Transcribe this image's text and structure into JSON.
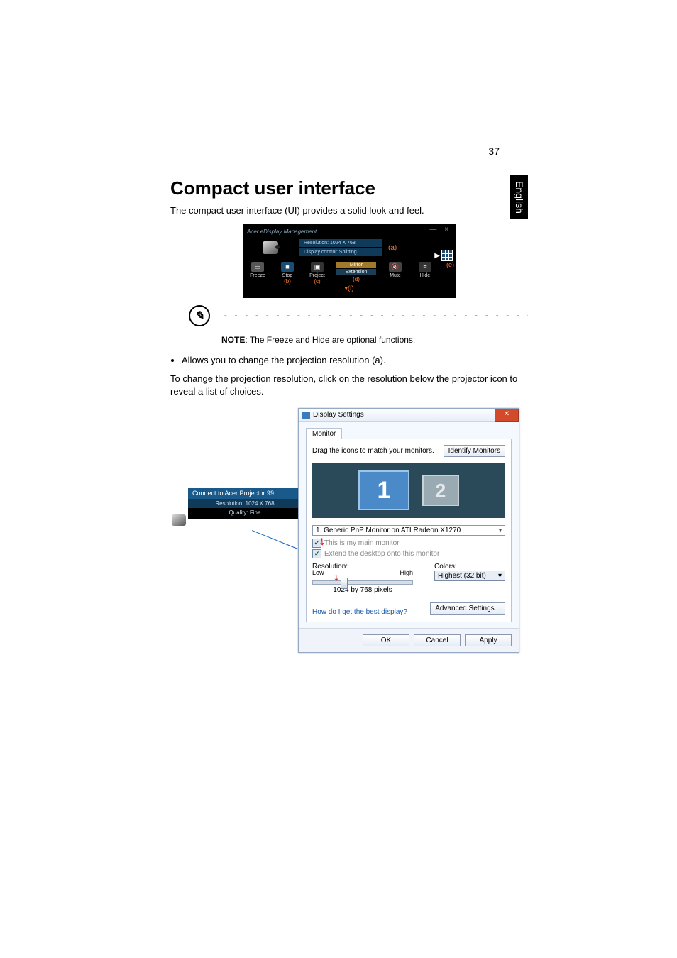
{
  "page": {
    "number": "37",
    "side_tab": "English"
  },
  "section": {
    "title": "Compact user interface",
    "intro": "The compact user interface (UI) provides a solid look and feel."
  },
  "compact_ui": {
    "window_title": "Acer eDisplay Management",
    "resolution_label": "Resolution: 1024 X 768",
    "display_status": "Display control: Splitting",
    "letter_a": "(a)",
    "letter_e": "(e)",
    "buttons": {
      "freeze": "Freeze",
      "stop": "Stop",
      "project": "Project",
      "mute": "Mute",
      "hide": "Hide"
    },
    "modes": {
      "mirror": "Mirror",
      "extension": "Extension"
    },
    "letter_b": "(b)",
    "letter_c": "(c)",
    "letter_d": "(d)",
    "letter_f": "(f)"
  },
  "note": {
    "label": "NOTE",
    "text": ": The Freeze and Hide are optional functions."
  },
  "bullet": {
    "item1": "Allows you to change the projection resolution (a)."
  },
  "body": {
    "change_res": "To change the projection resolution, click on the resolution below the projector icon to reveal a list of choices."
  },
  "connect_box": {
    "title": "Connect to Acer Projector 99",
    "resolution": "Resolution: 1024 X 768",
    "quality": "Quality: Fine"
  },
  "display_settings": {
    "title": "Display Settings",
    "tab": "Monitor",
    "drag_text": "Drag the icons to match your monitors.",
    "identify_btn": "Identify Monitors",
    "mon1": "1",
    "mon2": "2",
    "monitor_select": "1. Generic PnP Monitor on ATI Radeon X1270",
    "check_main": "This is my main monitor",
    "check_extend": "Extend the desktop onto this monitor",
    "resolution_label": "Resolution:",
    "low": "Low",
    "high": "High",
    "res_value": "1024 by 768 pixels",
    "colors_label": "Colors:",
    "colors_value": "Highest (32 bit)",
    "help_link": "How do I get the best display?",
    "advanced_btn": "Advanced Settings...",
    "ok": "OK",
    "cancel": "Cancel",
    "apply": "Apply"
  }
}
